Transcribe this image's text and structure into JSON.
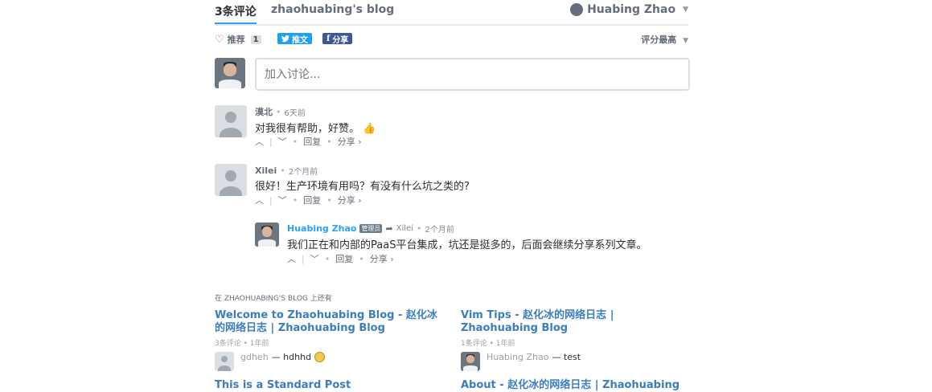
{
  "nav": {
    "tab_comments": "3条评论",
    "tab_blog": "zhaohuabing's blog",
    "user_name": "Huabing Zhao"
  },
  "bar": {
    "recommend_label": "推荐",
    "recommend_count": "1",
    "tweet_label": "推文",
    "share_label": "分享",
    "sort_label": "评分最高"
  },
  "composer": {
    "placeholder": "加入讨论..."
  },
  "comments": [
    {
      "author": "漠北",
      "time": "6天前",
      "text": "对我很有帮助，好赞。",
      "reply": "回复",
      "share": "分享 ›"
    },
    {
      "author": "Xilei",
      "time": "2个月前",
      "text": "很好！生产环境有用吗？有没有什么坑之类的?",
      "reply": "回复",
      "share": "分享 ›"
    },
    {
      "author": "Huabing Zhao",
      "badge": "管理员",
      "reply_to": "Xilei",
      "time": "2个月前",
      "text": "我们正在和内部的PaaS平台集成，坑还是挺多的，后面会继续分享系列文章。",
      "reply": "回复",
      "share": "分享 ›"
    }
  ],
  "more": {
    "title": "在 ZHAOHUABING'S BLOG 上还有",
    "items": [
      {
        "title": "Welcome to Zhaohuabing Blog - 赵化冰的网络日志 | Zhaohuabing Blog",
        "meta": "3条评论 • 1年前",
        "who": "gdheh",
        "text": "— hdhhd"
      },
      {
        "title": "Vim Tips - 赵化冰的网络日志 | Zhaohuabing Blog",
        "meta": "1条评论 • 1年前",
        "who": "Huabing Zhao",
        "text": "— test"
      },
      {
        "title": "This is a Standard Post"
      },
      {
        "title": "About - 赵化冰的网络日志 | Zhaohuabing"
      }
    ]
  },
  "colors": {
    "accent": "#2e9fff",
    "link": "#3b7ebf",
    "twitter": "#1da1f2",
    "facebook": "#3b5998"
  }
}
